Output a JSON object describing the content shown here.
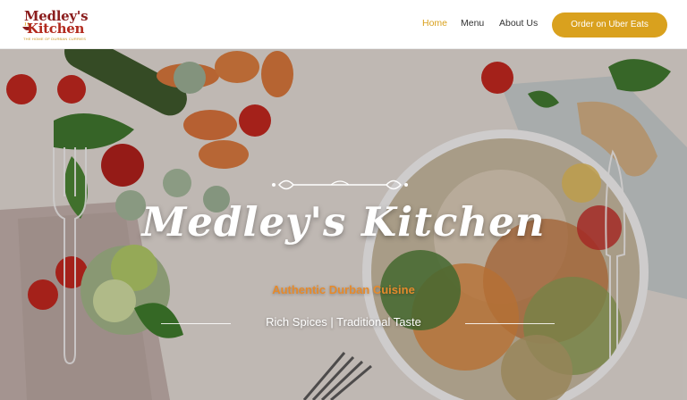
{
  "header": {
    "logo": {
      "line1": "Medley's",
      "line2": "Kitchen",
      "tagline": "THE HOME OF DURBAN CURRIES"
    },
    "nav": [
      {
        "label": "Home",
        "active": true
      },
      {
        "label": "Menu",
        "active": false
      },
      {
        "label": "About Us",
        "active": false
      }
    ],
    "cta_label": "Order on Uber Eats"
  },
  "hero": {
    "title": "Medley's Kitchen",
    "subtitle": "Authentic Durban Cuisine",
    "tagline": "Rich Spices | Traditional Taste"
  },
  "colors": {
    "accent": "#d9a11e",
    "subtitle": "#e58a2c",
    "logo_red": "#8b1d1d"
  }
}
